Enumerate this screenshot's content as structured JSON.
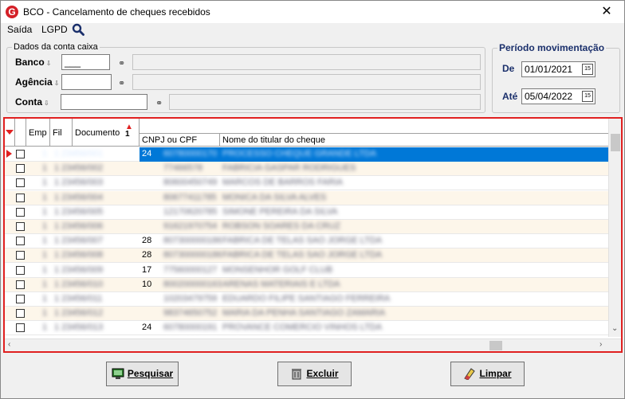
{
  "window": {
    "title": "BCO - Cancelamento de cheques recebidos",
    "icon_letter": "G",
    "close_symbol": "✕"
  },
  "menu": {
    "items": [
      "Saída",
      "LGPD"
    ]
  },
  "account_group": {
    "legend": "Dados da conta caixa",
    "banco_label": "Banco",
    "banco_value": "___",
    "agencia_label": "Agência",
    "agencia_value": "",
    "conta_label": "Conta",
    "conta_value": ""
  },
  "period_group": {
    "legend": "Período movimentação",
    "de_label": "De",
    "de_value": "01/01/2021",
    "ate_label": "Até",
    "ate_value": "05/04/2022"
  },
  "grid": {
    "columns": {
      "emp": "Emp",
      "fil": "Fil",
      "documento": "Documento",
      "sort_number": "1",
      "cnpj": "CNPJ ou CPF",
      "nome": "Nome do titular do cheque"
    },
    "rows": [
      {
        "doc": "1 23456/001",
        "cnpj_prefix": "24",
        "cnpj": "60780000170",
        "nome": "PROCESSO CHEQUE GRANDE LTDA"
      },
      {
        "doc": "1 23456/002",
        "cnpj_prefix": "",
        "cnpj": "77466578",
        "nome": "FABRICIA GASPAR RODRIGUES"
      },
      {
        "doc": "1 23456/003",
        "cnpj_prefix": "",
        "cnpj": "80600450749",
        "nome": "MARCOS DE BARROS FARIA"
      },
      {
        "doc": "1 23456/004",
        "cnpj_prefix": "",
        "cnpj": "80677411785",
        "nome": "MONICA DA SILVA ALVES"
      },
      {
        "doc": "1 23456/005",
        "cnpj_prefix": "",
        "cnpj": "12170620785",
        "nome": "SIMONE PEREIRA DA SILVA"
      },
      {
        "doc": "1 23456/006",
        "cnpj_prefix": "",
        "cnpj": "91621970754",
        "nome": "ROBSON SOARES DA CRUZ"
      },
      {
        "doc": "1 23456/007",
        "cnpj_prefix": "28",
        "cnpj": "807300000186",
        "nome": "FABRICA DE TELAS SAO JORGE LTDA"
      },
      {
        "doc": "1 23456/008",
        "cnpj_prefix": "28",
        "cnpj": "807300000186",
        "nome": "FABRICA DE TELAS SAO JORGE LTDA"
      },
      {
        "doc": "1 23456/009",
        "cnpj_prefix": "17",
        "cnpj": "77560000127",
        "nome": "MONSENHOR GOLF CLUB"
      },
      {
        "doc": "1 23456/010",
        "cnpj_prefix": "10",
        "cnpj": "800200000163",
        "nome": "ARENAS MATERIAIS E LTDA"
      },
      {
        "doc": "1 23456/011",
        "cnpj_prefix": "",
        "cnpj": "10203479759",
        "nome": "EDUARDO FILIPE SANTIAGO FERREIRA"
      },
      {
        "doc": "1 23456/012",
        "cnpj_prefix": "",
        "cnpj": "98374650752",
        "nome": "MARIA DA PENHA SANTIAGO ZAMARIA"
      },
      {
        "doc": "1 23456/013",
        "cnpj_prefix": "24",
        "cnpj": "60780000191",
        "nome": "PROVANCE COMERCIO VINHOS LTDA"
      }
    ]
  },
  "buttons": {
    "pesquisar": "Pesquisar",
    "excluir": "Excluir",
    "limpar": "Limpar"
  },
  "icons": {
    "app": "app-logo-icon",
    "search": "search-icon",
    "binoculars": "binoculars-icon",
    "calendar": "calendar-icon",
    "monitor": "monitor-icon",
    "trash": "trash-icon",
    "eraser": "eraser-icon"
  }
}
